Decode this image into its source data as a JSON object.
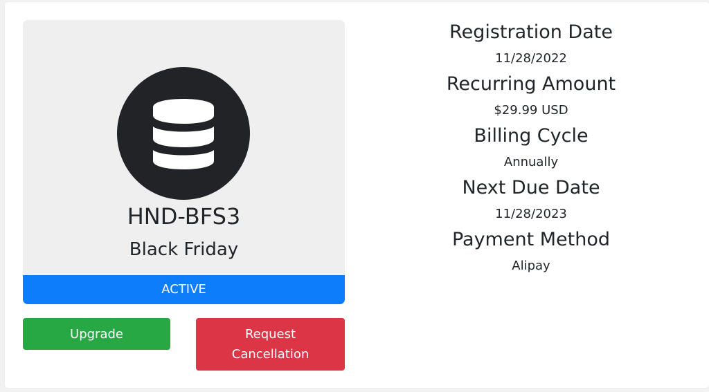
{
  "product": {
    "icon": "database-icon",
    "name": "HND-BFS3",
    "group": "Black Friday",
    "status": "ACTIVE"
  },
  "actions": {
    "upgrade_label": "Upgrade",
    "cancel_label_line1": "Request",
    "cancel_label_line2": "Cancellation"
  },
  "details": [
    {
      "label": "Registration Date",
      "value": "11/28/2022"
    },
    {
      "label": "Recurring Amount",
      "value": "$29.99 USD"
    },
    {
      "label": "Billing Cycle",
      "value": "Annually"
    },
    {
      "label": "Next Due Date",
      "value": "11/28/2023"
    },
    {
      "label": "Payment Method",
      "value": "Alipay"
    }
  ],
  "colors": {
    "status_bar": "#0d7dfc",
    "upgrade_button": "#28a745",
    "cancel_button": "#dc3545",
    "icon_circle": "#222326"
  }
}
